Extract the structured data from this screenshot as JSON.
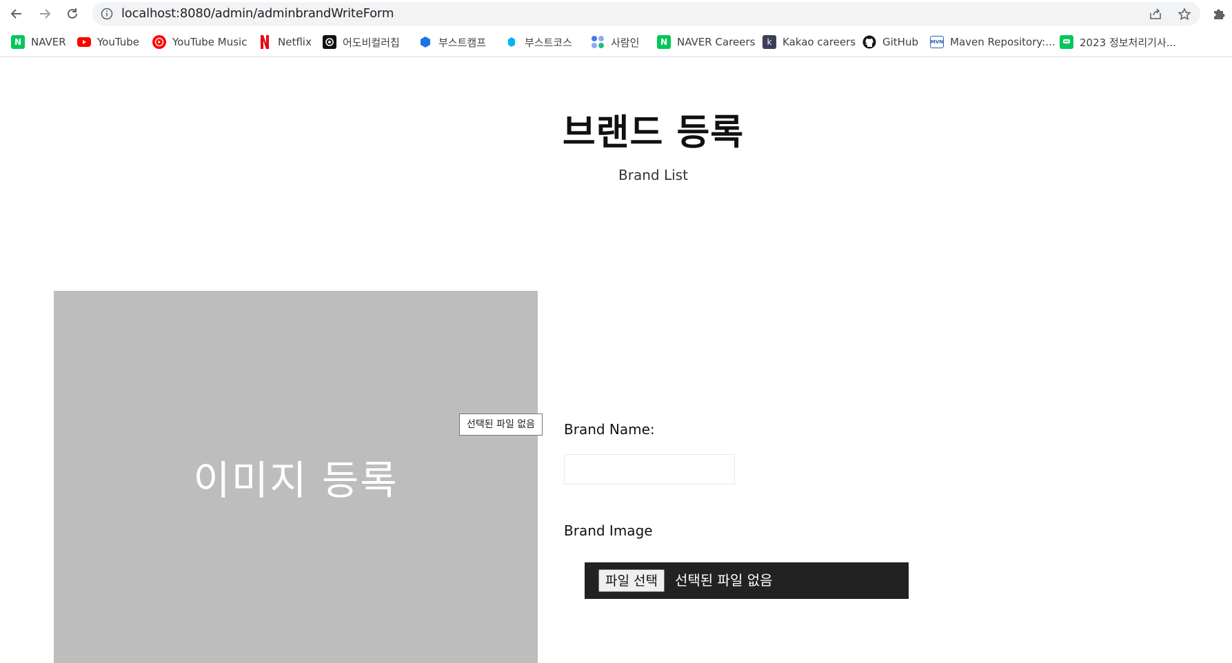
{
  "browser": {
    "url": "localhost:8080/admin/adminbrandWriteForm",
    "bookmarks": [
      {
        "label": "NAVER",
        "icon": "naver-icon",
        "color": "#03c75a"
      },
      {
        "label": "YouTube",
        "icon": "youtube-icon",
        "color": "#ff0000"
      },
      {
        "label": "YouTube Music",
        "icon": "youtube-music-icon",
        "color": "#ff0000"
      },
      {
        "label": "Netflix",
        "icon": "netflix-icon",
        "color": "#e50914"
      },
      {
        "label": "어도비컬러칩",
        "icon": "adobe-color-icon",
        "color": "#111111"
      },
      {
        "label": "부스트캠프",
        "icon": "boostcamp-icon",
        "color": "#1a73e8"
      },
      {
        "label": "부스트코스",
        "icon": "boostcourse-icon",
        "color": "#00b6f0"
      },
      {
        "label": "사람인",
        "icon": "saramin-icon",
        "color": "#4876ef"
      },
      {
        "label": "NAVER Careers",
        "icon": "naver-careers-icon",
        "color": "#03c75a"
      },
      {
        "label": "Kakao careers",
        "icon": "kakao-careers-icon",
        "color": "#3c3f57"
      },
      {
        "label": "GitHub",
        "icon": "github-icon",
        "color": "#181717"
      },
      {
        "label": "Maven Repository:...",
        "icon": "maven-icon",
        "color": "#2a5db0"
      },
      {
        "label": "2023 정보처리기사...",
        "icon": "exam-bookmark-icon",
        "color": "#03c75a"
      }
    ]
  },
  "page": {
    "title": "브랜드 등록",
    "subtitle": "Brand List"
  },
  "image_upload": {
    "placeholder_text": "이미지 등록",
    "tooltip": "선택된 파일 없음"
  },
  "form": {
    "brand_name_label": "Brand Name:",
    "brand_name_value": "",
    "brand_image_label": "Brand Image",
    "file_button_label": "파일 선택",
    "file_status": "선택된 파일 없음"
  }
}
